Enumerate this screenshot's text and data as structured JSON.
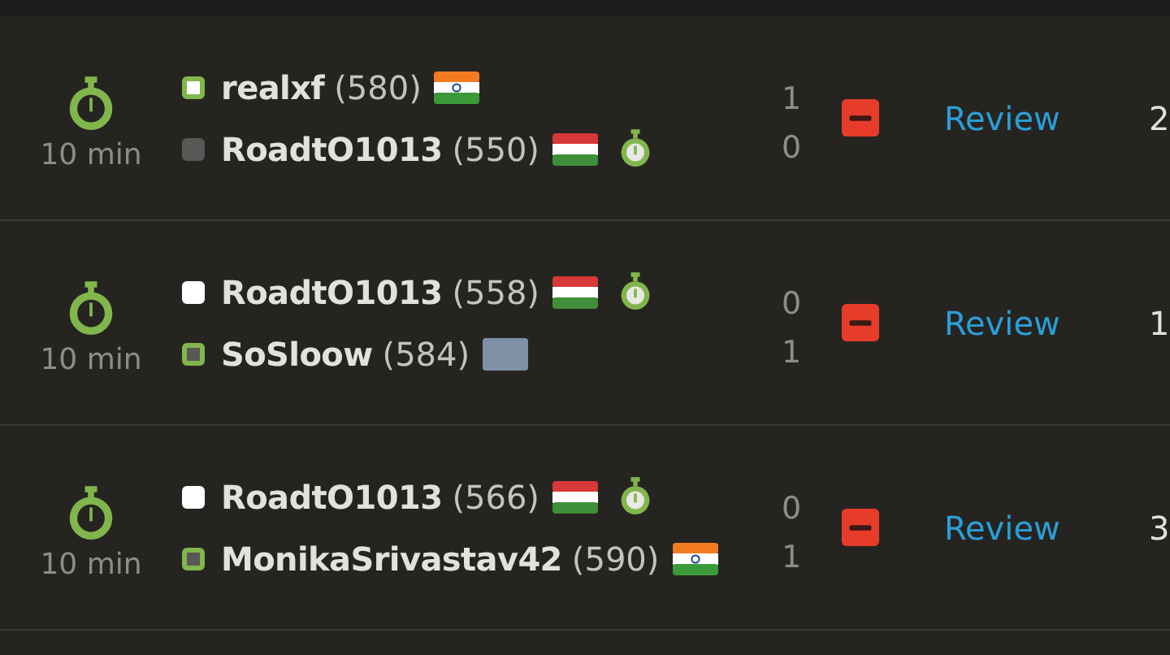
{
  "games": [
    {
      "time_control": "10 min",
      "players": [
        {
          "name": "realxf",
          "rating": "(580)",
          "white": true,
          "winner": true,
          "flag": {
            "kind": "india"
          },
          "timeout": false
        },
        {
          "name": "RoadtO1013",
          "rating": "(550)",
          "white": false,
          "winner": false,
          "flag": {
            "kind": "hungary"
          },
          "timeout": true
        }
      ],
      "scores": [
        "1",
        "0"
      ],
      "lost": true,
      "review": "Review",
      "column_6": "2"
    },
    {
      "time_control": "10 min",
      "players": [
        {
          "name": "RoadtO1013",
          "rating": "(558)",
          "white": true,
          "winner": false,
          "flag": {
            "kind": "hungary"
          },
          "timeout": true
        },
        {
          "name": "SoSloow",
          "rating": "(584)",
          "white": false,
          "winner": true,
          "flag": {
            "kind": "generic"
          },
          "timeout": false
        }
      ],
      "scores": [
        "0",
        "1"
      ],
      "lost": true,
      "review": "Review",
      "column_6": "1"
    },
    {
      "time_control": "10 min",
      "players": [
        {
          "name": "RoadtO1013",
          "rating": "(566)",
          "white": true,
          "winner": false,
          "flag": {
            "kind": "hungary"
          },
          "timeout": true
        },
        {
          "name": "MonikaSrivastav42",
          "rating": "(590)",
          "white": false,
          "winner": true,
          "flag": {
            "kind": "india"
          },
          "timeout": false
        }
      ],
      "scores": [
        "0",
        "1"
      ],
      "lost": true,
      "review": "Review",
      "column_6": "3"
    }
  ]
}
